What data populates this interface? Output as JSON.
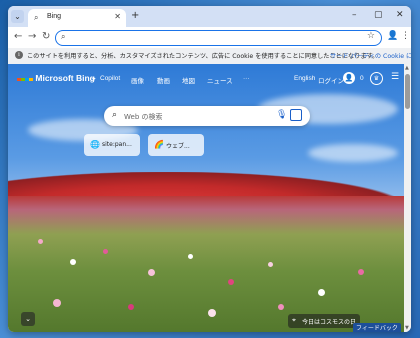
{
  "browser": {
    "tab_title": "Bing",
    "tab_menu_icon": "chevron-down-icon",
    "new_tab_symbol": "+",
    "close_symbol": "✕",
    "window_controls": [
      "–",
      "▢",
      "✕"
    ],
    "address_value": ""
  },
  "cookie_bar": {
    "message": "このサイトを利用すると、分析、カスタマイズされたコンテンツ、広告に Cookie を使用することに同意したことになります。",
    "link": "サード パーティの Cookie に関"
  },
  "bing": {
    "logo_text": "Microsoft Bing",
    "nav": [
      "Copilot",
      "画像",
      "動画",
      "地図",
      "ニュース",
      "···"
    ],
    "language": "English",
    "login": "ログイン",
    "reward_count": "0",
    "search_placeholder": "Web の検索",
    "quick_links": [
      {
        "label": "site:pan...",
        "icon": "globe-icon"
      },
      {
        "label": "ウェブ...",
        "icon": "rainbow-icon"
      }
    ],
    "caption": "今日はコスモスの日",
    "feedback": "フィードバック"
  },
  "colors": {
    "accent": "#1a73e8",
    "link": "#1a5fc8",
    "feedback_bg": "#1d4f9a"
  }
}
